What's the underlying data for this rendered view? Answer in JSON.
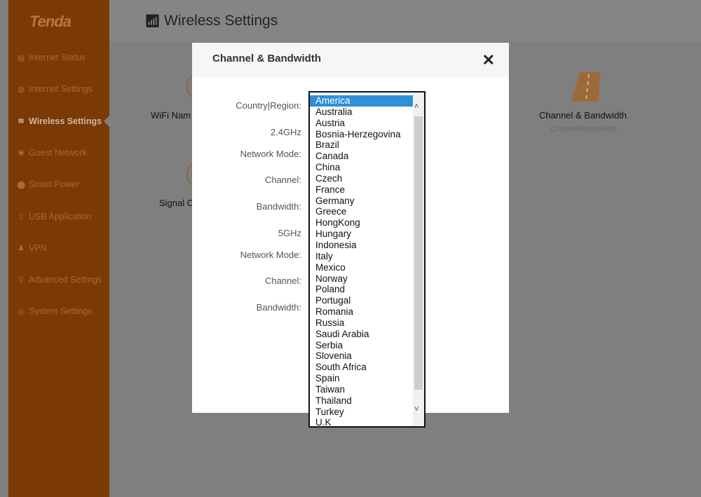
{
  "brand": "Tenda",
  "sidebar": {
    "items": [
      {
        "label": "Internet Status",
        "icon": "monitor-icon"
      },
      {
        "label": "Internet Settings",
        "icon": "globe-icon"
      },
      {
        "label": "Wireless Settings",
        "icon": "wifi-icon",
        "active": true
      },
      {
        "label": "Guest Network",
        "icon": "guest-icon"
      },
      {
        "label": "Smart Power",
        "icon": "location-icon"
      },
      {
        "label": "USB Application",
        "icon": "usb-icon"
      },
      {
        "label": "VPN",
        "icon": "vpn-icon"
      },
      {
        "label": "Advanced Settings",
        "icon": "wrench-icon"
      },
      {
        "label": "System Settings",
        "icon": "gear-icon"
      }
    ]
  },
  "header": {
    "title": "Wireless Settings"
  },
  "background": {
    "wifi_name": "WiFi Nam",
    "signal": "Signal C",
    "channel_title": "Channel & Bandwidth",
    "channel_sub": "Channel/Bandwidth"
  },
  "modal": {
    "title": "Channel & Bandwidth",
    "close": "✕",
    "labels": [
      "Country|Region:",
      "2.4GHz",
      "Network Mode:",
      "Channel:",
      "Bandwidth:",
      "5GHz",
      "Network Mode:",
      "Channel:",
      "Bandwidth:"
    ],
    "selected": "America",
    "options": [
      "America",
      "Australia",
      "Austria",
      "Bosnia-Herzegovina",
      "Brazil",
      "Canada",
      "China",
      "Czech",
      "France",
      "Germany",
      "Greece",
      "HongKong",
      "Hungary",
      "Indonesia",
      "Italy",
      "Mexico",
      "Norway",
      "Poland",
      "Portugal",
      "Romania",
      "Russia",
      "Saudi Arabia",
      "Serbia",
      "Slovenia",
      "South Africa",
      "Spain",
      "Taiwan",
      "Thailand",
      "Turkey",
      "U.K"
    ]
  },
  "colors": {
    "sidebar": "#7b3a03",
    "overlay": "#7f7f7f",
    "selection": "#2f8fd8"
  }
}
